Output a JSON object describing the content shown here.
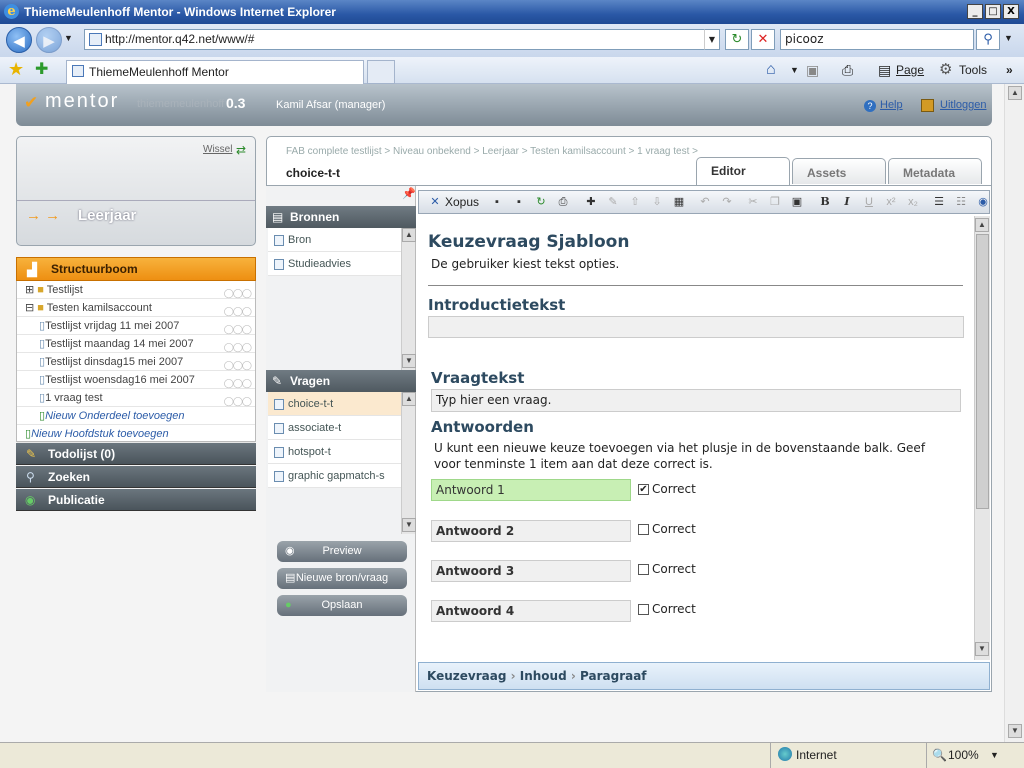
{
  "window": {
    "title": "ThiemeMeulenhoff Mentor - Windows Internet Explorer",
    "controls": [
      "_",
      "□",
      "X"
    ]
  },
  "browser": {
    "address": "http://mentor.q42.net/www/#",
    "search_value": "picooz",
    "tab_title": "ThiemeMeulenhoff Mentor",
    "commands": {
      "page": "Page",
      "tools": "Tools"
    }
  },
  "status": {
    "zone": "Internet",
    "zoom": "100%"
  },
  "app": {
    "logo_text": "mentor",
    "brand": "thiememeulenhoff",
    "version": "0.3",
    "user": "Kamil Afsar (manager)",
    "help": "Help",
    "logout": "Uitloggen",
    "switch": "Wissel",
    "level_label": "Leerjaar",
    "level_arrows": "→ →"
  },
  "structure": {
    "title": "Structuurboom",
    "items": [
      {
        "label": "Testlijst",
        "prefix": "⊞"
      },
      {
        "label": "Testen kamilsaccount",
        "prefix": "⊟"
      },
      {
        "label": "Testlijst vrijdag 11 mei 2007"
      },
      {
        "label": "Testlijst maandag 14 mei 2007"
      },
      {
        "label": "Testlijst dinsdag15 mei 2007"
      },
      {
        "label": "Testlijst woensdag16 mei 2007"
      },
      {
        "label": "1 vraag test"
      }
    ],
    "add_section": "Nieuw Onderdeel toevoegen",
    "add_chapter": "Nieuw Hoofdstuk toevoegen"
  },
  "sidebar_buttons": {
    "todo": "Todolijst (0)",
    "search": "Zoeken",
    "publish": "Publicatie"
  },
  "main": {
    "breadcrumb": "FAB complete testlijst > Niveau onbekend > Leerjaar > Testen kamilsaccount > 1 vraag test >",
    "item_title": "choice-t-t",
    "tabs": {
      "editor": "Editor",
      "assets": "Assets",
      "metadata": "Metadata"
    }
  },
  "sources": {
    "title": "Bronnen",
    "items": [
      "Bron",
      "Studieadvies"
    ]
  },
  "questions": {
    "title": "Vragen",
    "items": [
      "choice-t-t",
      "associate-t",
      "hotspot-t",
      "graphic gapmatch-s"
    ]
  },
  "actions": {
    "preview": "Preview",
    "new": "Nieuwe bron/vraag",
    "save": "Opslaan"
  },
  "editor": {
    "toolbar_brand": "Xopus",
    "template_title": "Keuzevraag Sjabloon",
    "template_desc": "De gebruiker kiest tekst opties.",
    "intro_heading": "Introductietekst",
    "question_heading": "Vraagtekst",
    "question_placeholder": "Typ hier een vraag.",
    "answers_heading": "Antwoorden",
    "answers_help": "U kunt een nieuwe keuze toevoegen via het plusje in de bovenstaande balk. Geef voor tenminste 1 item aan dat deze correct is.",
    "correct_label": "Correct",
    "answers": [
      {
        "label": "Antwoord 1",
        "checked": true
      },
      {
        "label": "Antwoord 2",
        "checked": false
      },
      {
        "label": "Antwoord 3",
        "checked": false
      },
      {
        "label": "Antwoord 4",
        "checked": false
      }
    ],
    "path": [
      "Keuzevraag",
      "Inhoud",
      "Paragraaf"
    ],
    "colors": {
      "selected_answer_bg": "#c8efb4",
      "accent_orange": "#f09a1e"
    }
  },
  "icons": [
    "ie-logo-icon",
    "back-icon",
    "forward-icon",
    "refresh-icon",
    "stop-icon",
    "search-icon",
    "star-icon",
    "home-icon",
    "feed-icon",
    "print-icon",
    "page-icon",
    "tools-icon",
    "check-logo-icon",
    "help-icon",
    "logout-icon",
    "switch-icon",
    "folder-icon",
    "file-icon",
    "pin-icon",
    "cut-icon",
    "copy-icon",
    "paste-icon",
    "bold-icon",
    "italic-icon",
    "underline-icon",
    "list-icon",
    "globe-icon"
  ]
}
